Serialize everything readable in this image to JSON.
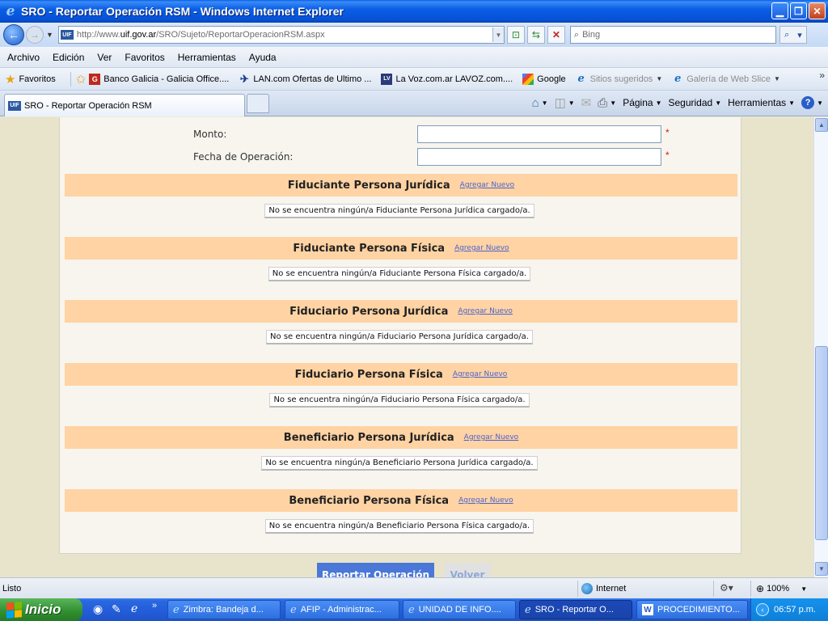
{
  "window": {
    "title": "SRO - Reportar Operación RSM - Windows Internet Explorer",
    "icon": "ie-logo-icon"
  },
  "address_bar": {
    "url_prefix": "http://www.",
    "url_domain": "uif.gov.ar",
    "url_path": "/SRO/Sujeto/ReportarOperacionRSM.aspx",
    "site_badge": "UIF",
    "search_placeholder": "Bing"
  },
  "menu": [
    "Archivo",
    "Edición",
    "Ver",
    "Favoritos",
    "Herramientas",
    "Ayuda"
  ],
  "favorites": {
    "label": "Favoritos",
    "items": [
      {
        "label": "Banco Galicia - Galicia Office....",
        "icon": "galicia-icon",
        "badge": "G"
      },
      {
        "label": "LAN.com Ofertas de Ultimo ...",
        "icon": "lan-icon",
        "badge": "✈"
      },
      {
        "label": "La Voz.com.ar  LAVOZ.com....",
        "icon": "lavoz-icon",
        "badge": "LV"
      },
      {
        "label": "Google",
        "icon": "google-icon",
        "badge": ""
      },
      {
        "label": "Sitios sugeridos",
        "icon": "ie-icon",
        "badge": "e"
      },
      {
        "label": "Galería de Web Slice",
        "icon": "ie-icon",
        "badge": "e"
      }
    ]
  },
  "tabs": [
    {
      "label": "SRO - Reportar Operación RSM",
      "badge": "UIF"
    }
  ],
  "command_bar": [
    "Página",
    "Seguridad",
    "Herramientas"
  ],
  "form": {
    "fields": [
      {
        "label": "Monto:",
        "value": "",
        "required_mark": "*"
      },
      {
        "label": "Fecha de Operación:",
        "value": "",
        "required_mark": "*"
      }
    ],
    "add_link": "Agregar Nuevo",
    "sections": [
      {
        "title": "Fiduciante Persona Jurídica",
        "empty": "No se encuentra ningún/a Fiduciante Persona Jurídica cargado/a."
      },
      {
        "title": "Fiduciante Persona Física",
        "empty": "No se encuentra ningún/a Fiduciante Persona Física cargado/a."
      },
      {
        "title": "Fiduciario Persona Jurídica",
        "empty": "No se encuentra ningún/a Fiduciario Persona Jurídica cargado/a."
      },
      {
        "title": "Fiduciario Persona Física",
        "empty": "No se encuentra ningún/a Fiduciario Persona Física cargado/a."
      },
      {
        "title": "Beneficiario Persona Jurídica",
        "empty": "No se encuentra ningún/a Beneficiario Persona Jurídica cargado/a."
      },
      {
        "title": "Beneficiario Persona Física",
        "empty": "No se encuentra ningún/a Beneficiario Persona Física cargado/a."
      }
    ],
    "submit_label": "Reportar Operación",
    "back_label": "Volver"
  },
  "status_bar": {
    "text": "Listo",
    "zone": "Internet",
    "zoom": "100%"
  },
  "taskbar": {
    "start_label": "Inicio",
    "items": [
      {
        "label": "Zimbra: Bandeja d...",
        "icon": "ie-icon"
      },
      {
        "label": "AFIP - Administrac...",
        "icon": "ie-icon"
      },
      {
        "label": "UNIDAD DE INFO....",
        "icon": "ie-icon"
      },
      {
        "label": "SRO - Reportar O...",
        "icon": "ie-icon"
      },
      {
        "label": "PROCEDIMIENTO...",
        "icon": "word-icon"
      }
    ],
    "clock": "06:57 p.m."
  },
  "colors": {
    "section_header": "#ffd3a3",
    "link": "#4b62d0",
    "required": "#d01818",
    "submit_button": "#4a77d8",
    "page_background": "#f7f5ee"
  }
}
